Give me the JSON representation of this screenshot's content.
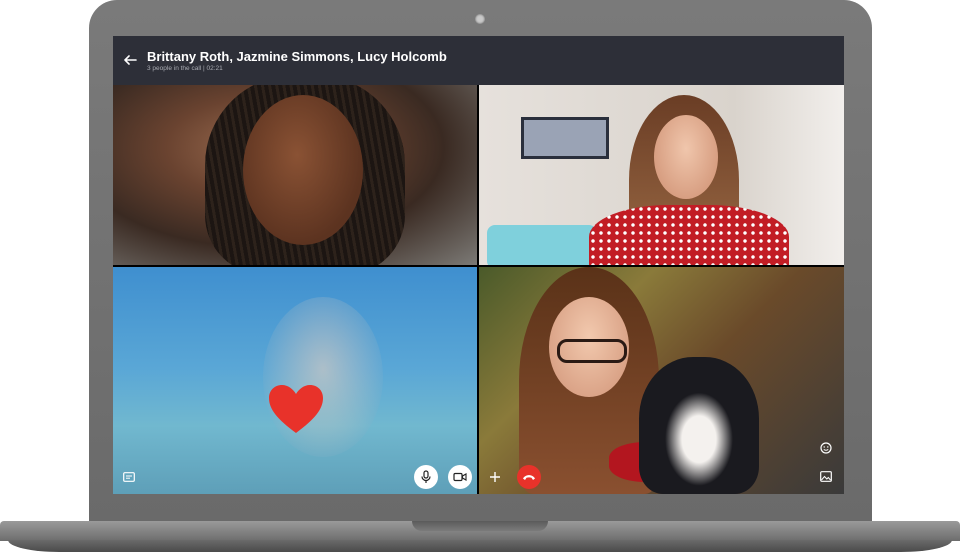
{
  "window": {
    "title": "Brittany Roth, Jazmine Simmons, Lucy Holcomb",
    "subtitle": "3 people in the call | 02:21"
  },
  "participants": [
    {
      "tile": "top-left",
      "kind": "video"
    },
    {
      "tile": "top-right",
      "kind": "video"
    },
    {
      "tile": "bottom-left",
      "kind": "video",
      "reaction": "heart-icon"
    },
    {
      "tile": "bottom-right",
      "kind": "video"
    }
  ],
  "controls": {
    "chat": "chat-icon",
    "mic": "microphone-icon",
    "video": "video-camera-icon",
    "add": "plus-icon",
    "end_call": "phone-hangup-icon",
    "emoji": "emoji-icon",
    "gallery": "image-icon"
  },
  "colors": {
    "titlebar": "#2d2f38",
    "end_call": "#e8322a",
    "heart": "#e8322a",
    "laptop_frame": "#6f6f6f"
  }
}
